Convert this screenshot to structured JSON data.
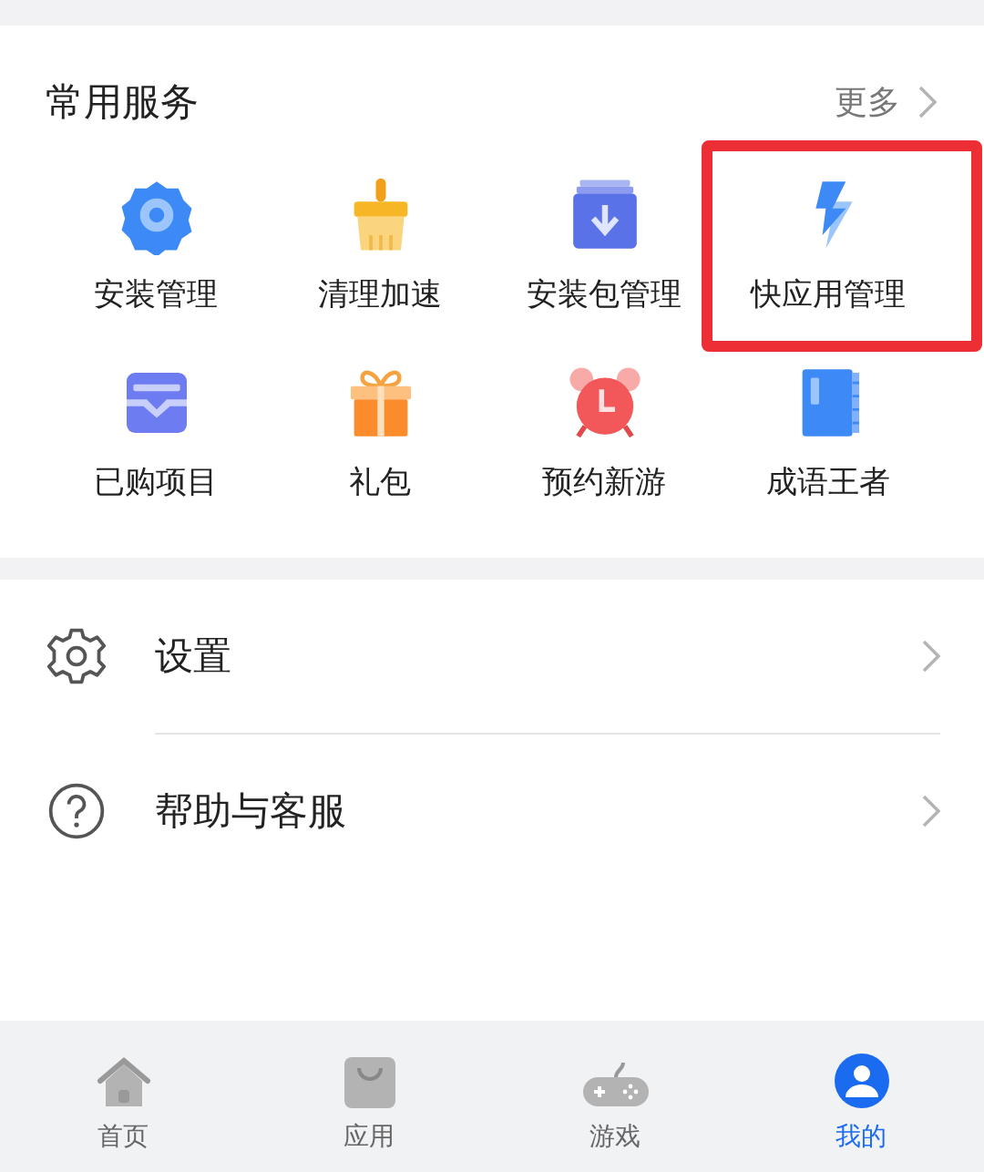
{
  "services": {
    "title": "常用服务",
    "more": "更多",
    "items": [
      {
        "kind": "gear",
        "label": "安装管理",
        "highlighted": false
      },
      {
        "kind": "brush",
        "label": "清理加速",
        "highlighted": false
      },
      {
        "kind": "package",
        "label": "安装包管理",
        "highlighted": false
      },
      {
        "kind": "bolt",
        "label": "快应用管理",
        "highlighted": true
      },
      {
        "kind": "wallet",
        "label": "已购项目",
        "highlighted": false
      },
      {
        "kind": "gift",
        "label": "礼包",
        "highlighted": false
      },
      {
        "kind": "alarm",
        "label": "预约新游",
        "highlighted": false
      },
      {
        "kind": "book",
        "label": "成语王者",
        "highlighted": false
      }
    ]
  },
  "menu": [
    {
      "kind": "settings",
      "label": "设置"
    },
    {
      "kind": "help",
      "label": "帮助与客服"
    }
  ],
  "tab_bar": [
    {
      "kind": "home",
      "label": "首页",
      "selected": false
    },
    {
      "kind": "store",
      "label": "应用",
      "selected": false
    },
    {
      "kind": "game",
      "label": "游戏",
      "selected": false
    },
    {
      "kind": "profile",
      "label": "我的",
      "selected": true
    }
  ]
}
